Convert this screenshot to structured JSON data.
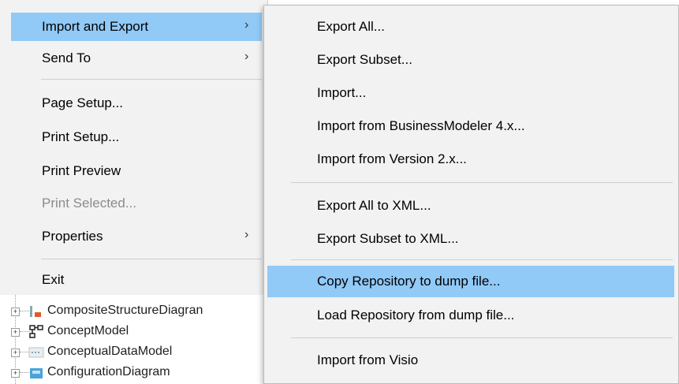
{
  "menu": {
    "items": [
      {
        "label": "Import and Export",
        "arrow": "›"
      },
      {
        "label": "Send To",
        "arrow": "›"
      },
      {
        "label": "Page Setup..."
      },
      {
        "label": "Print Setup..."
      },
      {
        "label": "Print Preview"
      },
      {
        "label": "Print Selected..."
      },
      {
        "label": "Properties",
        "arrow": "›"
      },
      {
        "label": "Exit"
      }
    ]
  },
  "submenu": {
    "items": [
      {
        "label": "Export All..."
      },
      {
        "label": "Export Subset..."
      },
      {
        "label": "Import..."
      },
      {
        "label": "Import from BusinessModeler 4.x..."
      },
      {
        "label": "Import from Version 2.x..."
      },
      {
        "label": "Export All to XML..."
      },
      {
        "label": "Export Subset to XML..."
      },
      {
        "label": "Copy Repository to dump file..."
      },
      {
        "label": "Load Repository from dump file..."
      },
      {
        "label": "Import from Visio"
      }
    ]
  },
  "tree": {
    "items": [
      {
        "label": "CompositeStructureDiagran",
        "expander": "+"
      },
      {
        "label": "ConceptModel",
        "expander": "+"
      },
      {
        "label": "ConceptualDataModel",
        "expander": "+"
      },
      {
        "label": "ConfigurationDiagram",
        "expander": "+"
      }
    ]
  },
  "colors": {
    "menu_bg": "#f2f2f2",
    "highlight": "#91c9f7",
    "disabled_text": "#8c8c8c"
  }
}
